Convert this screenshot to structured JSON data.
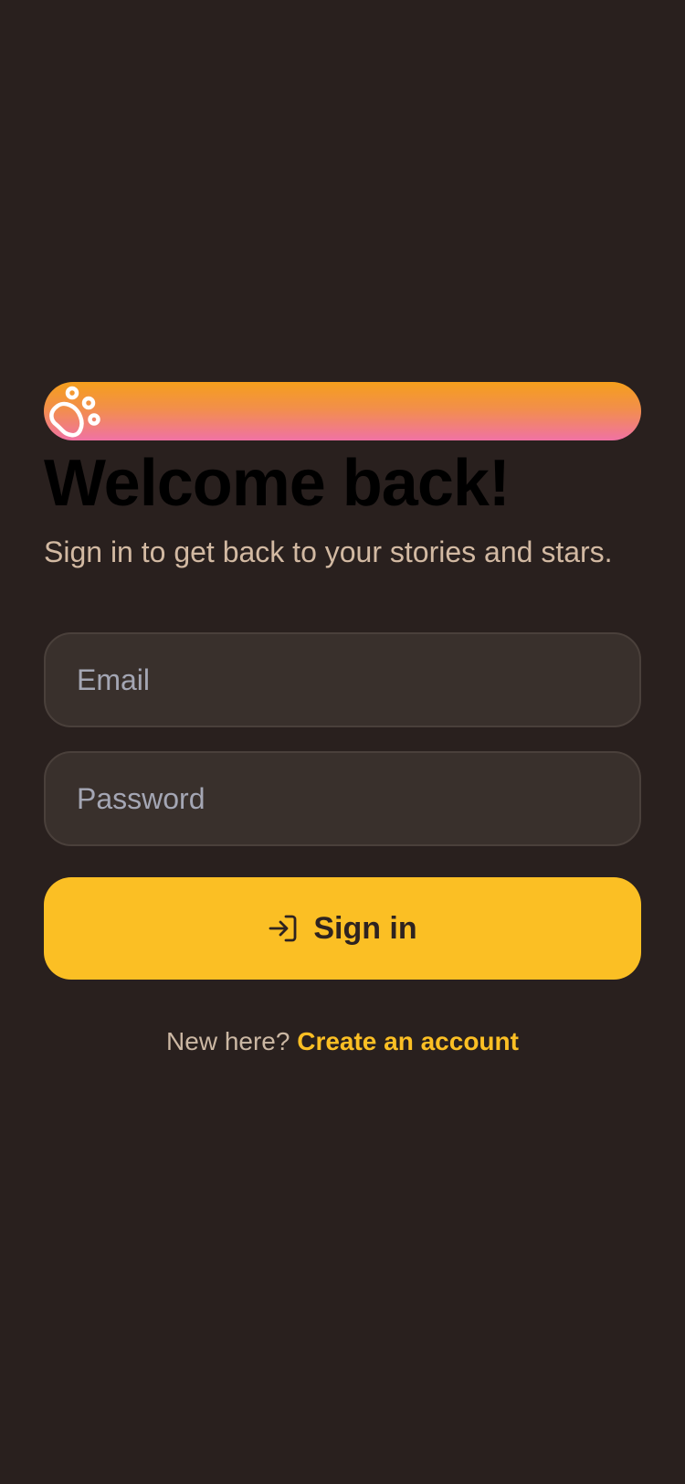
{
  "brand": {
    "icon": "paw-icon",
    "gradient": [
      "#f59f1c",
      "#f072a4"
    ]
  },
  "title": "Welcome back!",
  "subtitle": "Sign in to get back to your stories and stars.",
  "form": {
    "email": {
      "placeholder": "Email",
      "value": ""
    },
    "password": {
      "placeholder": "Password",
      "value": ""
    }
  },
  "signin_button": {
    "icon": "sign-in-icon",
    "label": "Sign in",
    "color": "#fbbf24"
  },
  "footer": {
    "prompt": "New here?",
    "link_label": "Create an account"
  },
  "colors": {
    "background": "#29201e",
    "accent": "#fbbf24",
    "field_background": "#39302c"
  }
}
